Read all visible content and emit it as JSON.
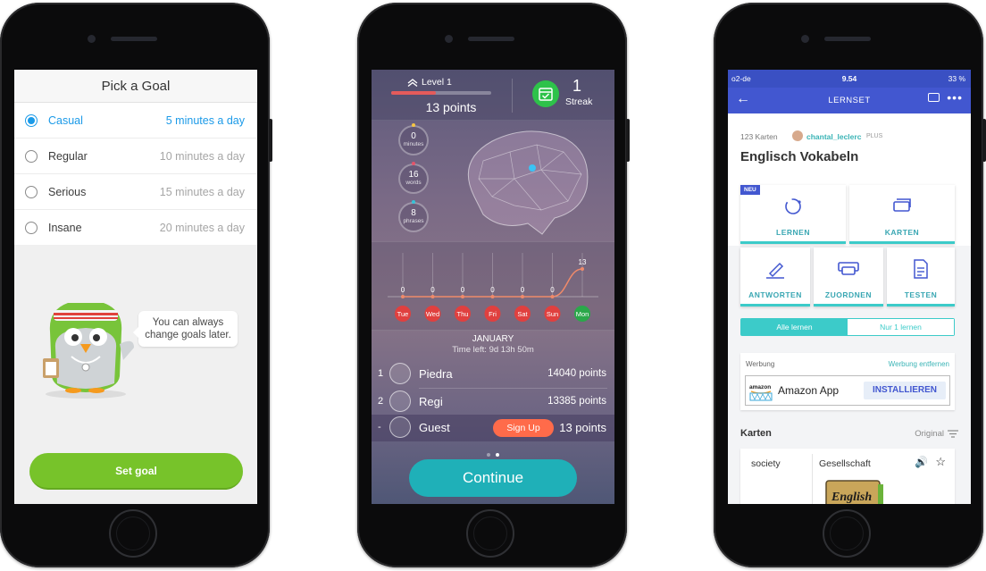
{
  "screen1": {
    "title": "Pick a Goal",
    "goals": [
      {
        "name": "Casual",
        "minutes": "5 minutes a day",
        "selected": true
      },
      {
        "name": "Regular",
        "minutes": "10 minutes a day",
        "selected": false
      },
      {
        "name": "Serious",
        "minutes": "15 minutes a day",
        "selected": false
      },
      {
        "name": "Insane",
        "minutes": "20 minutes a day",
        "selected": false
      }
    ],
    "bubble": "You can always change goals later.",
    "button": "Set goal",
    "colors": {
      "accent": "#1b9ae8",
      "button": "#77c32a"
    }
  },
  "screen2": {
    "level": "Level 1",
    "level_progress": 0.45,
    "points": "13 points",
    "streak_count": "1",
    "streak_label": "Streak",
    "stats": [
      {
        "value": "0",
        "label": "minutes",
        "color": "#f5c542"
      },
      {
        "value": "16",
        "label": "words",
        "color": "#e4546a"
      },
      {
        "value": "8",
        "label": "phrases",
        "color": "#35c3d8"
      }
    ],
    "chart_data": {
      "type": "line",
      "categories": [
        "Tue",
        "Wed",
        "Thu",
        "Fri",
        "Sat",
        "Sun",
        "Mon"
      ],
      "values": [
        0,
        0,
        0,
        0,
        0,
        0,
        13
      ]
    },
    "month": "JANUARY",
    "time_left": "Time left: 9d 13h 50m",
    "leaderboard": [
      {
        "rank": "1",
        "name": "Piedra",
        "points": "14040 points"
      },
      {
        "rank": "2",
        "name": "Regi",
        "points": "13385 points"
      },
      {
        "rank": "-",
        "name": "Guest",
        "points": "13 points",
        "action": "Sign Up"
      }
    ],
    "button": "Continue",
    "colors": {
      "accent": "#1fb0b8",
      "streak": "#2ec24a",
      "signup": "#ff6b4a"
    }
  },
  "screen3": {
    "status": {
      "carrier": "o2-de",
      "time": "9.54",
      "battery": "33 %"
    },
    "nav_title": "LERNSET",
    "card_count": "123 Karten",
    "username": "chantal_leclerc",
    "user_badge": "PLUS",
    "set_title": "Englisch Vokabeln",
    "new_badge": "NEU",
    "modes": [
      "LERNEN",
      "KARTEN",
      "ANTWORTEN",
      "ZUORDNEN",
      "TESTEN"
    ],
    "toggle": {
      "all": "Alle lernen",
      "one": "Nur 1 lernen"
    },
    "ad": {
      "label": "Werbung",
      "remove": "Werbung entfernen",
      "app": "Amazon App",
      "logo": "amazon",
      "install": "INSTALLIEREN"
    },
    "cards_header": "Karten",
    "sort": "Original",
    "card": {
      "term": "society",
      "definition": "Gesellschaft",
      "image_text": "English"
    },
    "colors": {
      "primary": "#4257d0",
      "teal": "#3ccbc9"
    }
  }
}
